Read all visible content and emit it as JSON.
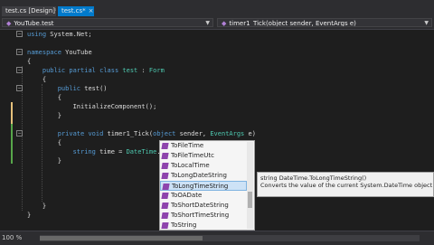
{
  "tabs": [
    {
      "label": "test.cs [Design]*",
      "close": "×"
    },
    {
      "label": "test.cs*",
      "close": "×"
    }
  ],
  "nav": {
    "left": "YouTube.test",
    "right": "timer1_Tick(object sender, EventArgs e)"
  },
  "code": {
    "lines": [
      {
        "parts": [
          {
            "t": "using",
            "c": "kw"
          },
          {
            "t": " System.Net;"
          }
        ]
      },
      {
        "parts": [
          {
            "t": ""
          }
        ]
      },
      {
        "parts": [
          {
            "t": "namespace",
            "c": "kw"
          },
          {
            "t": " YouTube"
          }
        ]
      },
      {
        "parts": [
          {
            "t": "{"
          }
        ]
      },
      {
        "parts": [
          {
            "t": "    "
          },
          {
            "t": "public",
            "c": "kw"
          },
          {
            "t": " "
          },
          {
            "t": "partial",
            "c": "kw"
          },
          {
            "t": " "
          },
          {
            "t": "class",
            "c": "kw"
          },
          {
            "t": " "
          },
          {
            "t": "test",
            "c": "ty"
          },
          {
            "t": " : "
          },
          {
            "t": "Form",
            "c": "ty"
          }
        ]
      },
      {
        "parts": [
          {
            "t": "    {"
          }
        ]
      },
      {
        "parts": [
          {
            "t": "        "
          },
          {
            "t": "public",
            "c": "kw"
          },
          {
            "t": " test()"
          }
        ]
      },
      {
        "parts": [
          {
            "t": "        {"
          }
        ]
      },
      {
        "parts": [
          {
            "t": "            InitializeComponent();"
          }
        ]
      },
      {
        "parts": [
          {
            "t": "        }"
          }
        ]
      },
      {
        "parts": [
          {
            "t": ""
          }
        ]
      },
      {
        "parts": [
          {
            "t": "        "
          },
          {
            "t": "private",
            "c": "kw"
          },
          {
            "t": " "
          },
          {
            "t": "void",
            "c": "kw"
          },
          {
            "t": " timer1_Tick("
          },
          {
            "t": "object",
            "c": "kw"
          },
          {
            "t": " sender, "
          },
          {
            "t": "EventArgs",
            "c": "ty"
          },
          {
            "t": " e)"
          }
        ]
      },
      {
        "parts": [
          {
            "t": "        {"
          }
        ]
      },
      {
        "parts": [
          {
            "t": "            "
          },
          {
            "t": "string",
            "c": "kw"
          },
          {
            "t": " time = "
          },
          {
            "t": "DateTime",
            "c": "ty"
          },
          {
            "t": ".Now."
          },
          {
            "t": "|",
            "c": "caret"
          }
        ]
      },
      {
        "parts": [
          {
            "t": "        }"
          }
        ]
      },
      {
        "parts": [
          {
            "t": ""
          }
        ]
      },
      {
        "parts": [
          {
            "t": ""
          }
        ]
      },
      {
        "parts": [
          {
            "t": ""
          }
        ]
      },
      {
        "parts": [
          {
            "t": ""
          }
        ]
      },
      {
        "parts": [
          {
            "t": "    }"
          }
        ]
      },
      {
        "parts": [
          {
            "t": "}"
          }
        ]
      }
    ]
  },
  "intellisense": {
    "items": [
      "ToFileTime",
      "ToFileTimeUtc",
      "ToLocalTime",
      "ToLongDateString",
      "ToLongTimeString",
      "ToOADate",
      "ToShortDateString",
      "ToShortTimeString",
      "ToString"
    ],
    "selected": "ToLongTimeString",
    "icon": "method-icon",
    "icon_color": "#8e44ad"
  },
  "tooltip": {
    "signature": "string DateTime.ToLongTimeString()",
    "description": "Converts the value of the current System.DateTime object to its equivalent long time string representation."
  },
  "status": {
    "zoom": "100 %"
  },
  "colors": {
    "editor_bg": "#1e1e1e",
    "keyword": "#569cd6",
    "type": "#4ec9b0",
    "selection": "#cde2f6"
  }
}
